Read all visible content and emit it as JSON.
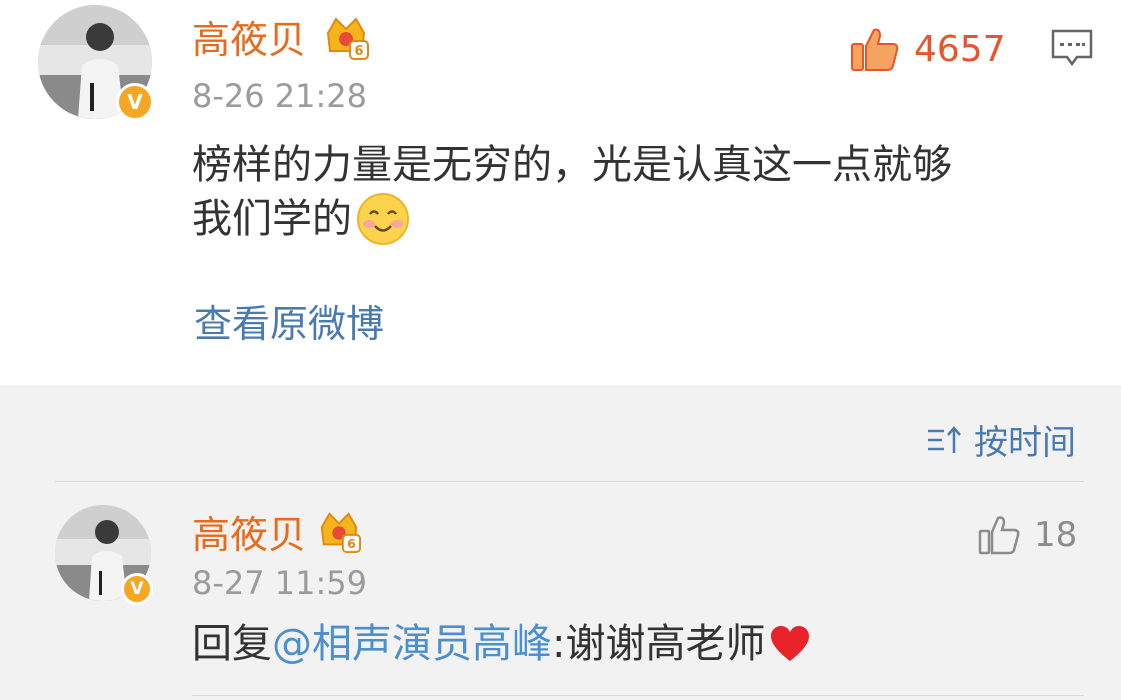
{
  "main_comment": {
    "username": "高筱贝",
    "timestamp": "8-26 21:28",
    "text_line1": "榜样的力量是无穷的，光是认真这一点就够",
    "text_line2": "我们学的",
    "emoji": "smile-emoji",
    "likes": "4657",
    "view_original": "查看原微博",
    "verified_mark": "V",
    "member_level": "6"
  },
  "replies_header": {
    "sort_label": "按时间"
  },
  "reply": {
    "username": "高筱贝",
    "timestamp": "8-27 11:59",
    "reply_prefix": "回复",
    "mention": "@相声演员高峰",
    "reply_text": ":谢谢高老师",
    "likes": "18",
    "verified_mark": "V",
    "member_level": "6"
  },
  "colors": {
    "username": "#e86b1c",
    "link": "#4a8fce",
    "like_active": "#e8542c",
    "verified": "#f5a623",
    "replies_bg": "#f2f2f2"
  }
}
